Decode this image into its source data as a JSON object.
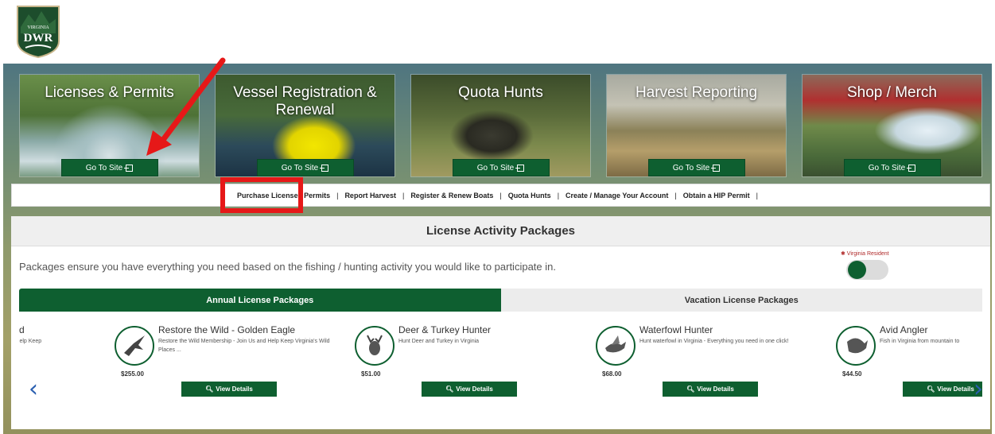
{
  "logo": {
    "top_text": "VIRGINIA",
    "main_text": "DWR"
  },
  "tiles": [
    {
      "title": "Licenses & Permits",
      "button": "Go To Site"
    },
    {
      "title": "Vessel Registration & Renewal",
      "button": "Go To Site"
    },
    {
      "title": "Quota Hunts",
      "button": "Go To Site"
    },
    {
      "title": "Harvest Reporting",
      "button": "Go To Site"
    },
    {
      "title": "Shop / Merch",
      "button": "Go To Site"
    }
  ],
  "nav": {
    "items": [
      "Purchase License / Permits",
      "Report Harvest",
      "Register & Renew Boats",
      "Quota Hunts",
      "Create / Manage Your Account",
      "Obtain a HIP Permit"
    ],
    "separator": "|"
  },
  "panel": {
    "heading": "License Activity Packages",
    "description": "Packages ensure you have everything you need based on the fishing / hunting activity you would like to participate in.",
    "resident_label": "✱ Virginia Resident",
    "tabs": [
      "Annual License Packages",
      "Vacation License Packages"
    ]
  },
  "cards": [
    {
      "title": "d",
      "desc": "oin Us and Help Keep",
      "price": "",
      "button": ""
    },
    {
      "title": "Restore the Wild - Golden Eagle",
      "desc": "Restore the Wild Membership - Join Us and Help Keep Virginia's Wild Places ...",
      "price": "$255.00",
      "button": "View Details",
      "icon": "eagle-icon"
    },
    {
      "title": "Deer & Turkey Hunter",
      "desc": "Hunt Deer and Turkey in Virginia",
      "price": "$51.00",
      "button": "View Details",
      "icon": "deer-icon"
    },
    {
      "title": "Waterfowl Hunter",
      "desc": "Hunt waterfowl in Virginia - Everything you need in one click!",
      "price": "$68.00",
      "button": "View Details",
      "icon": "duck-icon"
    },
    {
      "title": "Avid Angler",
      "desc": "Fish in Virginia from mountain to",
      "price": "$44.50",
      "button": "View Details",
      "icon": "fish-icon"
    }
  ],
  "colors": {
    "brand_green": "#0e5f30",
    "highlight_red": "#e61818",
    "arrow_blue": "#2a5fb0"
  }
}
